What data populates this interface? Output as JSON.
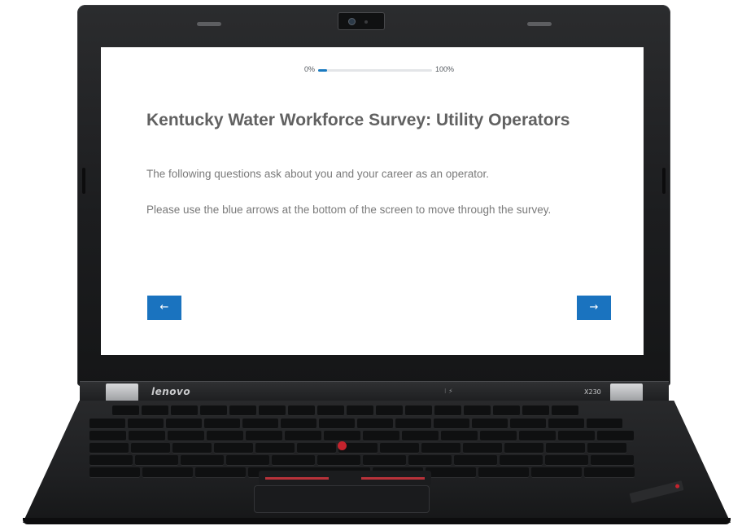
{
  "progress": {
    "start_label": "0%",
    "end_label": "100%",
    "percent": 8
  },
  "survey": {
    "title": "Kentucky Water Workforce Survey: Utility Operators",
    "paragraph_1": "The following questions ask about you and your career as an operator.",
    "paragraph_2": "Please use the blue arrows at the bottom of the screen to move through the survey."
  },
  "nav": {
    "back_label": "←",
    "next_label": "→"
  },
  "device": {
    "brand_logo": "lenovo",
    "model": "X230"
  },
  "colors": {
    "accent": "#1a73bf",
    "title_text": "#616161",
    "body_text": "#7a7a7a"
  },
  "icons": {
    "back": "arrow-left-icon",
    "next": "arrow-right-icon"
  }
}
